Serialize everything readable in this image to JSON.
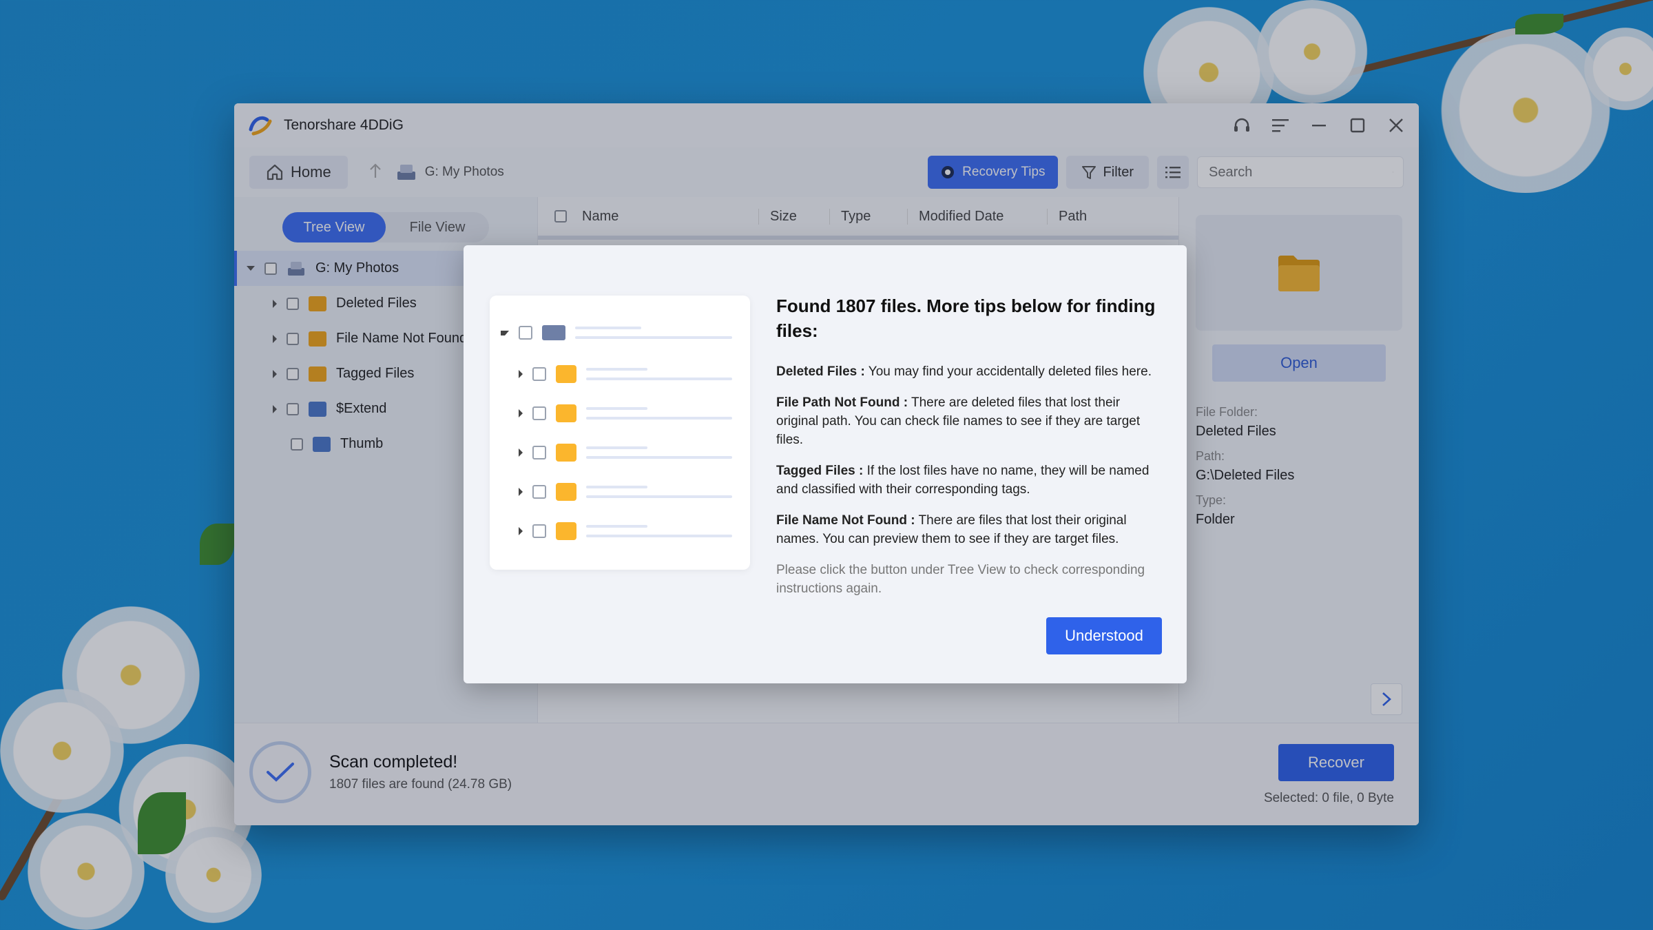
{
  "window": {
    "title": "Tenorshare 4DDiG"
  },
  "toolbar": {
    "home_label": "Home",
    "breadcrumb_label": "G: My Photos",
    "recovery_tips_label": "Recovery Tips",
    "filter_label": "Filter",
    "search_placeholder": "Search"
  },
  "left_pane": {
    "tree_view_label": "Tree View",
    "file_view_label": "File View",
    "items": [
      {
        "label": "G: My Photos",
        "icon": "drive-icon",
        "expanded": true
      },
      {
        "label": "Deleted Files",
        "icon": "deleted-folder-icon"
      },
      {
        "label": "File Name Not Found",
        "icon": "no-name-folder-icon"
      },
      {
        "label": "Tagged Files",
        "icon": "tagged-folder-icon"
      },
      {
        "label": "$Extend",
        "icon": "folder-icon"
      },
      {
        "label": "Thumb",
        "icon": "folder-icon"
      }
    ]
  },
  "table": {
    "columns": [
      "Name",
      "Size",
      "Type",
      "Modified Date",
      "Path"
    ]
  },
  "preview": {
    "open_label": "Open",
    "folder_label": "File Folder:",
    "folder_value": "Deleted Files",
    "path_label": "Path:",
    "path_value": "G:\\Deleted Files",
    "type_label": "Type:",
    "type_value": "Folder"
  },
  "status": {
    "title": "Scan completed!",
    "subtitle": "1807 files are found (24.78 GB)",
    "recover_label": "Recover",
    "selected_info": "Selected: 0 file, 0 Byte"
  },
  "modal": {
    "title": "Found 1807 files. More tips below for finding files:",
    "tips": [
      {
        "term": "Deleted Files :",
        "text": " You may find your accidentally deleted files here."
      },
      {
        "term": "File Path Not Found :",
        "text": " There are deleted files that lost their original path. You can check file names to see if they are target files."
      },
      {
        "term": "Tagged Files :",
        "text": " If the lost files have no name, they will be named and classified with their corresponding tags."
      },
      {
        "term": "File Name Not Found :",
        "text": " There are files that lost their original names. You can preview them to see if they are target files."
      }
    ],
    "note": "Please click the button under Tree View to check corresponding instructions again.",
    "button_label": "Understood"
  },
  "colors": {
    "accent": "#2f62ea",
    "desktop": "#1a8fd8",
    "folder_yellow": "#f2a51a"
  }
}
